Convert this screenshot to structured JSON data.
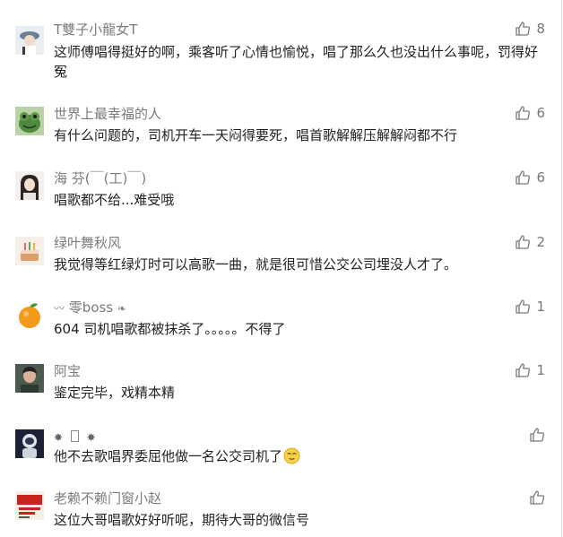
{
  "comments": [
    {
      "nickname": "T雙子小龍女T",
      "text": "这师傅唱得挺好的啊，乘客听了心情也愉悦，唱了那么久也没出什么事呢，罚得好冤",
      "likes": "8",
      "avatar": "girl-with-hat-icon"
    },
    {
      "nickname": "世界上最幸福的人",
      "text": "有什么问题的，司机开车一天闷得要死，唱首歌解解压解解闷都不行",
      "likes": "6",
      "avatar": "frog-icon"
    },
    {
      "nickname": "海 芬(￣(工)￣)",
      "text": "唱歌都不给...难受哦",
      "likes": "6",
      "avatar": "woman-portrait-icon"
    },
    {
      "nickname": "绿叶舞秋风",
      "text": "我觉得等红绿灯时可以高歌一曲，就是很可惜公交公司埋没人才了。",
      "likes": "2",
      "avatar": "cake-icon"
    },
    {
      "nickname": "零boss",
      "text": "604 司机唱歌都被抹杀了。。。。。不得了",
      "likes": "1",
      "avatar": "orange-fruit-icon"
    },
    {
      "nickname": "阿宝",
      "text": "鉴定完毕，戏精本精",
      "likes": "1",
      "avatar": "man-portrait-icon"
    },
    {
      "nickname": "",
      "text": "他不去歌唱界委屈他做一名公交司机了",
      "likes": "",
      "avatar": "astronaut-icon"
    },
    {
      "nickname": "老赖不赖门窗小赵",
      "text": "这位大哥唱歌好好听呢，期待大哥的微信号",
      "likes": "",
      "avatar": "red-poster-icon"
    }
  ]
}
